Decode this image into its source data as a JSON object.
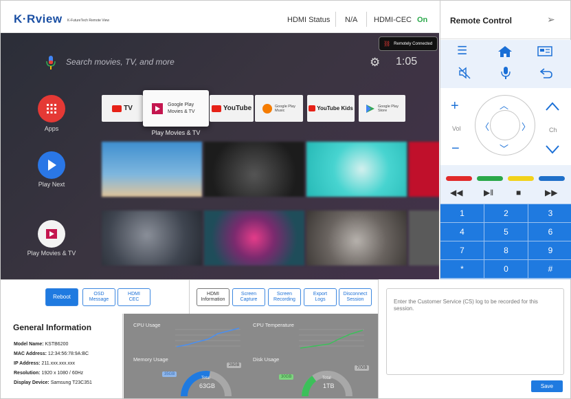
{
  "header": {
    "logo": "K·Rview",
    "logo_sub": "K-FutureTech Remote View",
    "hdmi_status_label": "HDMI Status",
    "hdmi_status_value": "N/A",
    "hdmi_cec_label": "HDMI-CEC",
    "hdmi_cec_value": "On"
  },
  "tv": {
    "remote_badge": "Remotely Connected",
    "search_placeholder": "Search movies, TV, and more",
    "clock": "1:05",
    "side": [
      {
        "label": "Apps",
        "icon": "grid-icon",
        "color": "#e53935"
      },
      {
        "label": "Play Next",
        "icon": "play-icon",
        "color": "#2a77e6"
      },
      {
        "label": "Play Movies & TV",
        "icon": "play-movies-icon",
        "color": "#b5174a"
      }
    ],
    "apps": [
      {
        "label": "YouTube TV",
        "text": "TV"
      },
      {
        "label": "Google Play Movies & TV",
        "text": "Google Play\nMovies & TV"
      },
      {
        "label": "YouTube",
        "text": "YouTube"
      },
      {
        "label": "Google Play Music",
        "text": "Google Play\nMusic"
      },
      {
        "label": "YouTube Kids",
        "text": "YouTube Kids"
      },
      {
        "label": "Google Play Store",
        "text": "Google Play\nStore"
      }
    ],
    "focused_app_label": "Play Movies & TV"
  },
  "remote": {
    "title": "Remote Control",
    "vol_label": "Vol",
    "ch_label": "Ch",
    "numpad": [
      "1",
      "2",
      "3",
      "4",
      "5",
      "6",
      "7",
      "8",
      "9",
      "*",
      "0",
      "#"
    ],
    "color_keys": [
      "#e12a2a",
      "#2aa84a",
      "#f2d21b",
      "#1f6fc9"
    ]
  },
  "actions": {
    "left": [
      "Reboot",
      "OSD\nMessage",
      "HDMI\nCEC"
    ],
    "middle": [
      "HDMI\nInformation",
      "Screen\nCapture",
      "Screen\nRecording",
      "Export\nLogs",
      "Disconnect\nSession"
    ]
  },
  "general_info": {
    "title": "General Information",
    "rows": [
      {
        "label": "Model Name:",
        "value": "KSTB6200"
      },
      {
        "label": "MAC Address:",
        "value": "12:34:56:78:9A:BC"
      },
      {
        "label": "IP Address:",
        "value": "211.xxx.xxx.xxx"
      },
      {
        "label": "Resolution:",
        "value": "1920  x  1080 / 60Hz"
      },
      {
        "label": "Display Device:",
        "value": "Samsung T23C351"
      }
    ]
  },
  "stats": {
    "cpu_usage_label": "CPU Usage",
    "cpu_temp_label": "CPU Temperature",
    "memory_label": "Memory Usage",
    "disk_label": "Disk Usage",
    "memory_total_label": "Total",
    "memory_total": "63GB",
    "memory_used_pill": "35GB",
    "memory_free_pill": "28GB",
    "memory_used_fraction": 0.55,
    "disk_total_label": "Total",
    "disk_total": "1TB",
    "disk_used_pill": "30GB",
    "disk_free_pill": "70GB",
    "disk_used_fraction": 0.3
  },
  "cs_log": {
    "placeholder": "Enter the Customer Service (CS) log to be recorded for this session.",
    "save_label": "Save"
  }
}
